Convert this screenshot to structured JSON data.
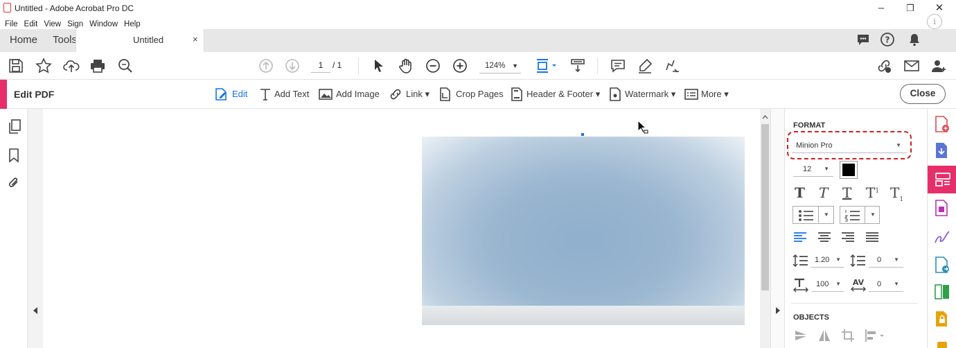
{
  "window": {
    "title": "Untitled - Adobe Acrobat Pro DC",
    "minimize": "–",
    "maximize": "❐",
    "close": "✕",
    "info": "i"
  },
  "menu": [
    "File",
    "Edit",
    "View",
    "Sign",
    "Window",
    "Help"
  ],
  "tabs": {
    "home": "Home",
    "tools": "Tools",
    "doc": "Untitled",
    "doc_close": "×"
  },
  "toolbar": {
    "page_current": "1",
    "page_total": "/ 1",
    "zoom": "124%"
  },
  "edit": {
    "title": "Edit PDF",
    "tools": [
      "Edit",
      "Add Text",
      "Add Image",
      "Link ▾",
      "Crop Pages",
      "Header & Footer ▾",
      "Watermark ▾",
      "More ▾"
    ],
    "close": "Close"
  },
  "format": {
    "heading": "FORMAT",
    "font": "Minion Pro",
    "size": "12",
    "line_spacing": "1.20",
    "para_spacing": "0",
    "scale": "100",
    "char_spacing": "0",
    "color": "#000000"
  },
  "objects": {
    "heading": "OBJECTS"
  },
  "colors": {
    "accent": "#e62e6b",
    "blue": "#1473e6",
    "highlight": "#d21f1f"
  }
}
